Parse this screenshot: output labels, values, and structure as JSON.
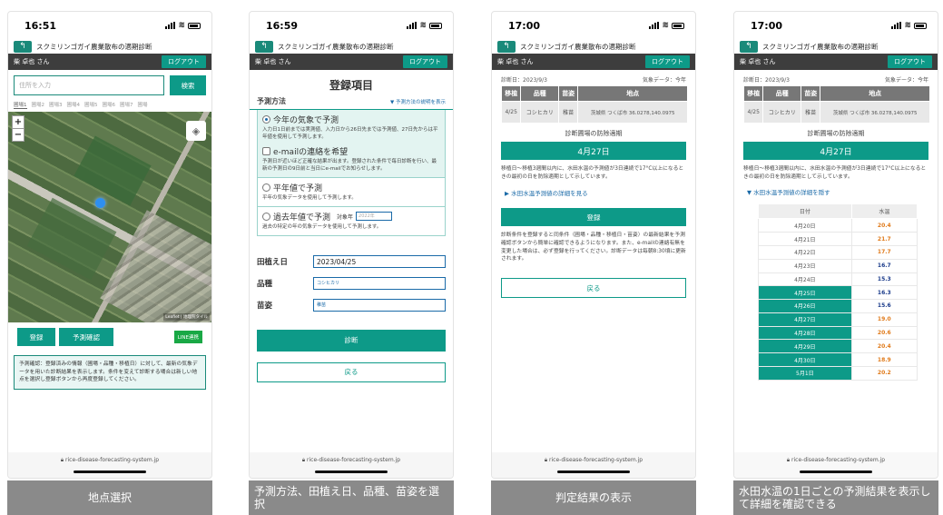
{
  "common": {
    "app_title": "スクミリンゴガイ農業散布の適期診断",
    "user": "柴 卓也 さん",
    "logout": "ログアウト",
    "url": "rice-disease-forecasting-system.jp"
  },
  "screen1": {
    "time": "16:51",
    "search_placeholder": "住所を入力",
    "search_button": "検索",
    "field_tabs": [
      "圃場1",
      "圃場2",
      "圃場3",
      "圃場4",
      "圃場5",
      "圃場6",
      "圃場7",
      "圃場"
    ],
    "zoom_in": "+",
    "zoom_out": "−",
    "attribution": "Leaflet | 地理院タイル",
    "register_button": "登録",
    "forecast_button": "予測確認",
    "line_button": "LINE連携",
    "note": "予測確認：登録済みの情報（圃場・品種・移植日）に対して、最新の気象データを用いた診断結果を表示します。条件を変えて診断する場合は新しい地点を選択し登録ボタンから再度登録してください。",
    "caption": "地点選択"
  },
  "screen2": {
    "time": "16:59",
    "title": "登録項目",
    "method_label": "予測方法",
    "method_link": "▼ 予測方法の説明を表示",
    "opt1_title": "今年の気象で予測",
    "opt1_desc": "入力日1日前までは実測値、入力日から26日先までは予測値、27日先からは平年値を使用して予測します。",
    "opt2_title": "e-mailの連絡を希望",
    "opt2_desc": "予測日が近いほど正確な結果が出ます。登録された条件で毎日診断を行い、最新の予測日の9日前と当日にe-mailでお知らせします。",
    "opt3_title": "平年値で予測",
    "opt3_desc": "平年の気象データを使用して予測します。",
    "opt4_title": "過去年値で予測",
    "opt4_year_label": "対象年",
    "opt4_year_placeholder": "2022年",
    "opt4_desc": "過去の特定の年の気象データを使用して予測します。",
    "planting_label": "田植え日",
    "planting_value": "2023/04/25",
    "variety_label": "品種",
    "variety_value": "コシヒカリ",
    "seedling_label": "苗姿",
    "seedling_value": "稚苗",
    "diagnose_button": "診断",
    "back_button": "戻る",
    "caption": "予測方法、田植え日、品種、苗姿を選択"
  },
  "screen3": {
    "time": "17:00",
    "diag_date": "診断日：2023/9/3",
    "weather": "気象データ：今年",
    "headers": [
      "移植",
      "品種",
      "苗姿",
      "地点"
    ],
    "row": [
      "4/25",
      "コシヒカリ",
      "稚苗",
      "茨城県 つくば市 36.0278,140.0975"
    ],
    "section_title": "診断圃場の防除適期",
    "result_date": "4月27日",
    "explanation": "移植日〜移植3週間以内に、水田水温の予測値が3日連続で17°C以上になるときの最初の日を防除適期として示しています。",
    "toggle": "▶ 水田水温予測値の詳細を見る",
    "register_button": "登録",
    "register_note": "診断条件を登録すると同条件（圃場・品種・移植日・苗姿）の最新結果を予測確認ボタンから簡単に確認できるようになります。また、e-mailの連絡有無を変更した場合は、必ず登録を行ってください。診断データは毎朝8:30頃に更新されます。",
    "back_button": "戻る",
    "caption": "判定結果の表示"
  },
  "screen4": {
    "time": "17:00",
    "toggle": "▼ 水田水温予測値の詳細を隠す",
    "col_date": "日付",
    "col_temp": "水温",
    "temps": [
      {
        "date": "4月20日",
        "temp": "20.4",
        "color": "#e07a1a"
      },
      {
        "date": "4月21日",
        "temp": "21.7",
        "color": "#e07a1a"
      },
      {
        "date": "4月22日",
        "temp": "17.7",
        "color": "#e07a1a"
      },
      {
        "date": "4月23日",
        "temp": "16.7",
        "color": "#1a3a8a"
      },
      {
        "date": "4月24日",
        "temp": "15.3",
        "color": "#1a3a8a"
      },
      {
        "date": "4月25日",
        "temp": "16.3",
        "color": "#1a3a8a"
      },
      {
        "date": "4月26日",
        "temp": "15.6",
        "color": "#1a3a8a"
      },
      {
        "date": "4月27日",
        "temp": "19.0",
        "color": "#e07a1a"
      },
      {
        "date": "4月28日",
        "temp": "20.6",
        "color": "#e07a1a"
      },
      {
        "date": "4月29日",
        "temp": "20.4",
        "color": "#e07a1a"
      },
      {
        "date": "4月30日",
        "temp": "18.9",
        "color": "#e07a1a"
      },
      {
        "date": "5月1日",
        "temp": "20.2",
        "color": "#e07a1a"
      }
    ],
    "caption": "水田水温の1日ごとの予測結果を表示して詳細を確認できる"
  }
}
